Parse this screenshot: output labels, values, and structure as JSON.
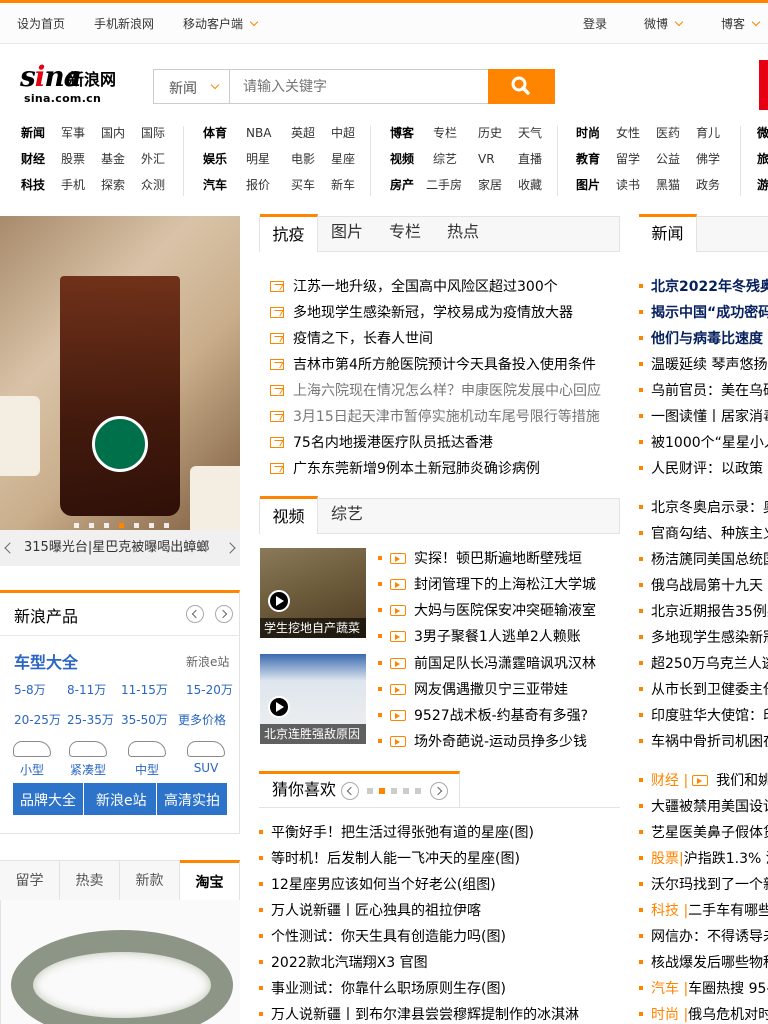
{
  "topbar": {
    "left": [
      "设为首页",
      "手机新浪网",
      "移动客户端"
    ],
    "right": [
      "登录",
      "微博",
      "博客"
    ]
  },
  "logo": {
    "text": "sina",
    "cn": "新浪网",
    "domain": "sina.com.cn"
  },
  "search": {
    "channel": "新闻",
    "placeholder": "请输入关键字"
  },
  "nav": {
    "cols": [
      [
        [
          "新闻",
          "军事",
          "国内",
          "国际"
        ],
        [
          "财经",
          "股票",
          "基金",
          "外汇"
        ],
        [
          "科技",
          "手机",
          "探索",
          "众测"
        ]
      ],
      [
        [
          "体育",
          "NBA",
          "英超",
          "中超"
        ],
        [
          "娱乐",
          "明星",
          "电影",
          "星座"
        ],
        [
          "汽车",
          "报价",
          "买车",
          "新车"
        ]
      ],
      [
        [
          "博客",
          "专栏",
          "历史",
          "天气"
        ],
        [
          "视频",
          "综艺",
          "VR",
          "直播"
        ],
        [
          "房产",
          "二手房",
          "家居",
          "收藏"
        ]
      ],
      [
        [
          "时尚",
          "女性",
          "医药",
          "育儿"
        ],
        [
          "教育",
          "留学",
          "公益",
          "佛学"
        ],
        [
          "图片",
          "读书",
          "黑猫",
          "政务"
        ]
      ],
      [
        [
          "微"
        ],
        [
          "旅"
        ],
        [
          "游"
        ]
      ]
    ]
  },
  "focus": {
    "caption": "315曝光台|星巴克被曝喝出蟑螂"
  },
  "products": {
    "title": "新浪产品",
    "car_title": "车型大全",
    "ec": "新浪e站",
    "prices": [
      "5-8万",
      "8-11万",
      "11-15万",
      "15-20万",
      "20-25万",
      "25-35万",
      "35-50万",
      "更多价格"
    ],
    "types": [
      "小型",
      "紧凑型",
      "中型",
      "SUV"
    ],
    "buttons": [
      "品牌大全",
      "新浪e站",
      "高清实拍"
    ]
  },
  "tabs2": [
    "留学",
    "热卖",
    "新款",
    "淘宝"
  ],
  "news_tabs": [
    "抗疫",
    "图片",
    "专栏",
    "热点"
  ],
  "news": [
    "江苏一地升级，全国高中风险区超过300个",
    "多地现学生感染新冠，学校易成为疫情放大器",
    "疫情之下，长春人世间",
    "吉林市第4所方舱医院预计今天具备投入使用条件",
    "上海六院现在情况怎么样？申康医院发展中心回应",
    "3月15日起天津市暂停实施机动车尾号限行等措施",
    "75名内地援港医疗队员抵达香港",
    "广东东莞新增9例本土新冠肺炎确诊病例"
  ],
  "video_tabs": [
    "视频",
    "综艺"
  ],
  "thumbs": [
    "学生挖地自产蔬菜",
    "北京连胜强敌原因"
  ],
  "videos": [
    "实探！顿巴斯遍地断壁残垣",
    "封闭管理下的上海松江大学城",
    "大妈与医院保安冲突砸输液室",
    "3男子聚餐1人逃单2人赖账",
    "前国足队长冯潇霆暗讽巩汉林",
    "网友偶遇撒贝宁三亚带娃",
    "9527战术板-约基奇有多强?",
    "场外奇葩说-运动员挣多少钱"
  ],
  "guess": {
    "title": "猜你喜欢"
  },
  "guess_list": [
    "平衡好手！把生活过得张弛有道的星座(图)",
    "等时机！后发制人能一飞冲天的星座(图)",
    "12星座男应该如何当个好老公(组图)",
    "万人说新疆丨匠心独具的祖拉伊喀",
    "个性测试：你天生具有创造能力吗(图)",
    "2022款北汽瑞翔X3 官图",
    "事业测试：你靠什么职场原则生存(图)",
    "万人说新疆丨到布尔津县尝尝穆辉提制作的冰淇淋"
  ],
  "right_tab": "新闻",
  "right_list_a": [
    "北京2022年冬残奥会",
    "揭示中国“成功密码",
    "他们与病毒比速度",
    "温暖延续 琴声悠扬",
    "乌前官员：美在乌研",
    "一图读懂丨居家消毒",
    "被1000个“星星小人",
    "人民财评：以政策"
  ],
  "right_list_b": [
    "北京冬奥启示录：奥",
    "官商勾结、种族主义",
    "杨洁篪同美国总统国",
    "俄乌战局第十九天",
    "北京近期报告35例感",
    "多地现学生感染新冠",
    "超250万乌克兰人逃",
    "从市长到卫健委主任",
    "印度驻华大使馆：印",
    "车祸中骨折司机困在"
  ],
  "right_list_c": [
    {
      "cat": "财经 |",
      "text": "我们和姚"
    },
    {
      "cat": "",
      "text": "大疆被禁用美国设计"
    },
    {
      "cat": "",
      "text": "艺星医美鼻子假体贷"
    },
    {
      "cat": "股票|",
      "text": "沪指跌1.3% 港"
    },
    {
      "cat": "",
      "text": "沃尔玛找到了一个新"
    },
    {
      "cat": "科技 |",
      "text": "二手车有哪些"
    },
    {
      "cat": "",
      "text": "网信办：不得诱导未"
    },
    {
      "cat": "",
      "text": "核战爆发后哪些物种"
    },
    {
      "cat": "汽车 |",
      "text": "车圈热搜 95-"
    },
    {
      "cat": "时尚 |",
      "text": "俄乌危机对时"
    }
  ]
}
